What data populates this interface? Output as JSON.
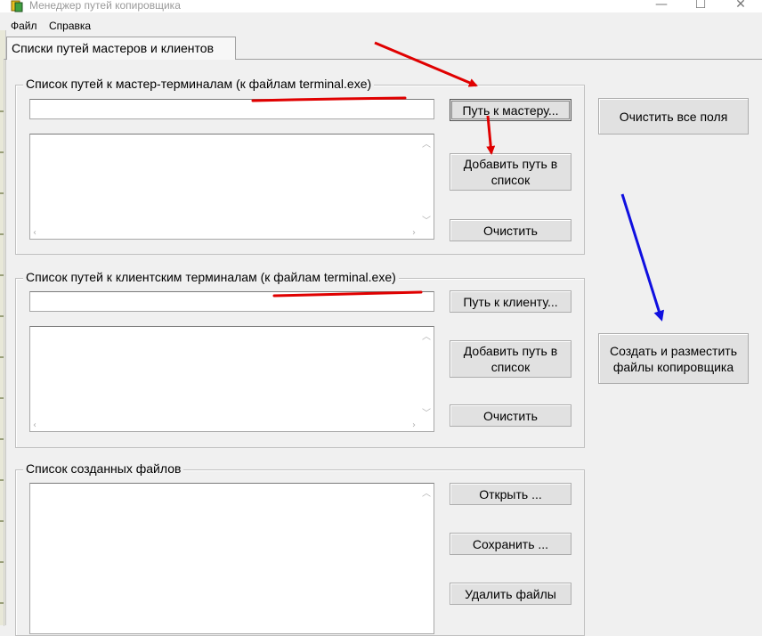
{
  "window": {
    "title": "Менеджер путей копировщика",
    "min_glyph": "—",
    "max_glyph": "☐",
    "close_glyph": "✕"
  },
  "menu": {
    "file": "Файл",
    "help": "Справка"
  },
  "tab": {
    "label": "Списки путей мастеров и клиентов"
  },
  "master_group": {
    "title": "Список путей к мастер-терминалам (к файлам terminal.exe)",
    "path_value": "",
    "browse_button": "Путь к мастеру...",
    "add_button": "Добавить путь в список",
    "clear_button": "Очистить"
  },
  "client_group": {
    "title": "Список путей к клиентским терминалам (к файлам terminal.exe)",
    "path_value": "",
    "browse_button": "Путь к клиенту...",
    "add_button": "Добавить путь в список",
    "clear_button": "Очистить"
  },
  "files_group": {
    "title": "Список созданных файлов",
    "open_button": "Открыть ...",
    "save_button": "Сохранить ...",
    "delete_button": "Удалить файлы"
  },
  "right_panel": {
    "clear_all_button": "Очистить все поля",
    "create_button": "Создать и разместить файлы копировщика"
  },
  "annotation_colors": {
    "red": "#e00000",
    "blue": "#1010e0"
  }
}
